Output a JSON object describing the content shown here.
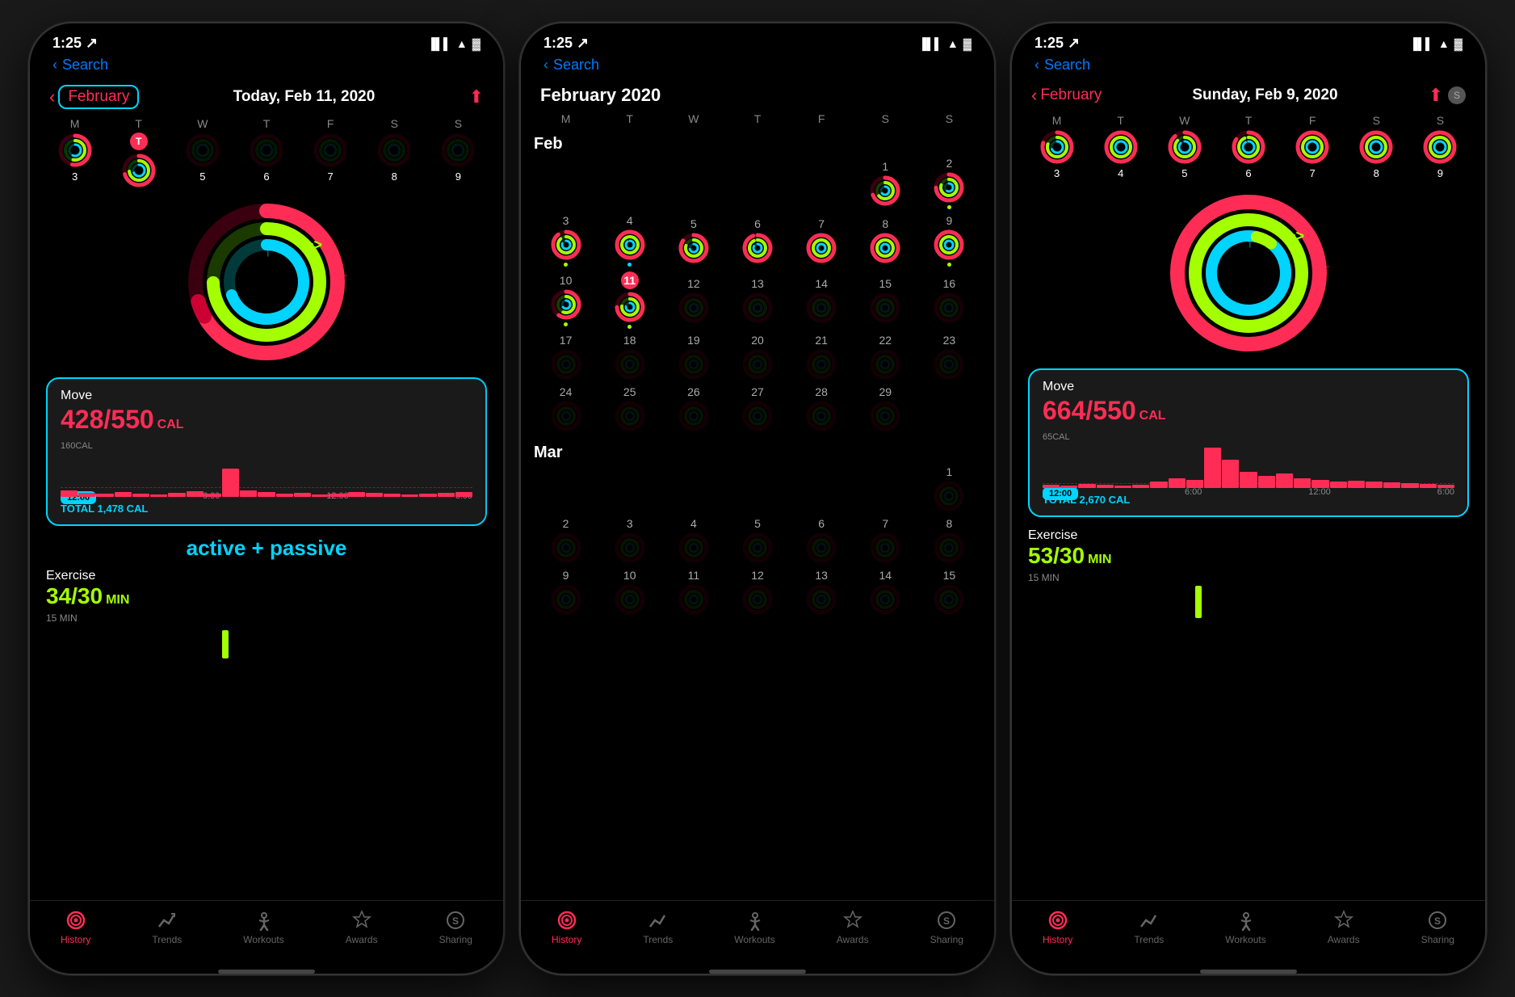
{
  "phones": [
    {
      "id": "phone1",
      "statusBar": {
        "time": "1:25",
        "arrow": "↗"
      },
      "searchBar": {
        "backLabel": "Search"
      },
      "header": {
        "backLabel": "February",
        "highlighted": true,
        "dateLabel": "Today, Feb 11, 2020",
        "shareIcon": "↑",
        "shareColor": "#FF2D55"
      },
      "weekDays": [
        "M",
        "T",
        "W",
        "T",
        "F",
        "S",
        "S"
      ],
      "weekDayNumbers": [
        "",
        "T",
        "",
        "",
        "",
        "",
        ""
      ],
      "weekNumbers": [
        3,
        4,
        5,
        6,
        7,
        8,
        9
      ],
      "hasRings": [
        true,
        true,
        false,
        false,
        false,
        false,
        false
      ],
      "moveCard": {
        "label": "Move",
        "value": "428/550",
        "unit": "CAL",
        "calLabel": "160CAL",
        "timeStart": "12:00",
        "timeMid": "6:00",
        "timeEnd": "12:00",
        "timeEnd2": "6:00",
        "total": "TOTAL 1,478 CAL",
        "showAnnotation": true,
        "annotationText": "active + passive"
      },
      "exercise": {
        "label": "Exercise",
        "value": "34/30",
        "unit": "MIN",
        "minLabel": "15 MIN",
        "color": "#A4FF00"
      },
      "tabs": [
        {
          "label": "History",
          "active": true,
          "icon": "history"
        },
        {
          "label": "Trends",
          "active": false,
          "icon": "trends"
        },
        {
          "label": "Workouts",
          "active": false,
          "icon": "workouts"
        },
        {
          "label": "Awards",
          "active": false,
          "icon": "awards"
        },
        {
          "label": "Sharing",
          "active": false,
          "icon": "sharing"
        }
      ]
    },
    {
      "id": "phone2",
      "statusBar": {
        "time": "1:25",
        "arrow": "↗"
      },
      "searchBar": {
        "backLabel": "Search"
      },
      "calendarMode": true,
      "calendarTitle": "February 2020",
      "tabs": [
        {
          "label": "History",
          "active": true,
          "icon": "history"
        },
        {
          "label": "Trends",
          "active": false,
          "icon": "trends"
        },
        {
          "label": "Workouts",
          "active": false,
          "icon": "workouts"
        },
        {
          "label": "Awards",
          "active": false,
          "icon": "awards"
        },
        {
          "label": "Sharing",
          "active": false,
          "icon": "sharing"
        }
      ]
    },
    {
      "id": "phone3",
      "statusBar": {
        "time": "1:25",
        "arrow": "↗"
      },
      "searchBar": {
        "backLabel": "Search"
      },
      "header": {
        "backLabel": "February",
        "highlighted": false,
        "dateLabel": "Sunday, Feb 9, 2020",
        "shareIcon": "↑",
        "shareColor": "#FF2D55",
        "avatarRight": true
      },
      "weekDays": [
        "M",
        "T",
        "W",
        "T",
        "F",
        "S",
        "S"
      ],
      "weekNumbers": [
        3,
        4,
        5,
        6,
        7,
        8,
        9
      ],
      "hasRings": [
        true,
        true,
        true,
        true,
        true,
        true,
        true
      ],
      "moveCard": {
        "label": "Move",
        "value": "664/550",
        "unit": "CAL",
        "calLabel": "65CAL",
        "timeStart": "12:00",
        "timeMid": "6:00",
        "timeEnd": "12:00",
        "timeEnd2": "6:00",
        "total": "TOTAL 2,670 CAL",
        "showAnnotation": false
      },
      "exercise": {
        "label": "Exercise",
        "value": "53/30",
        "unit": "MIN",
        "minLabel": "15 MIN",
        "color": "#A4FF00"
      },
      "tabs": [
        {
          "label": "History",
          "active": true,
          "icon": "history"
        },
        {
          "label": "Trends",
          "active": false,
          "icon": "trends"
        },
        {
          "label": "Workouts",
          "active": false,
          "icon": "workouts"
        },
        {
          "label": "Awards",
          "active": false,
          "icon": "awards"
        },
        {
          "label": "Sharing",
          "active": false,
          "icon": "sharing"
        }
      ]
    }
  ],
  "ui": {
    "tabLabels": {
      "history": "History",
      "trends": "Trends",
      "workouts": "Workouts",
      "awards": "Awards",
      "sharing": "Sharing"
    }
  }
}
